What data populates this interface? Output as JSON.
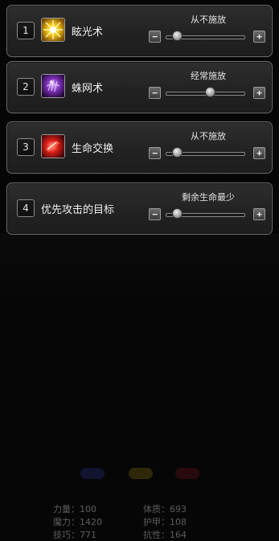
{
  "rules": [
    {
      "index": "1",
      "name": "眩光术",
      "icon": "glare-spell-icon",
      "mode": "从不施放",
      "level": 0.0
    },
    {
      "index": "2",
      "name": "蛛网术",
      "icon": "spider-web-spell-icon",
      "mode": "经常施放",
      "level": 0.5
    },
    {
      "index": "3",
      "name": "生命交换",
      "icon": "life-swap-spell-icon",
      "mode": "从不施放",
      "level": 0.0
    },
    {
      "index": "4",
      "name": "优先攻击的目标",
      "icon": "",
      "mode": "剩余生命最少",
      "level": 0.0
    }
  ],
  "buttons": {
    "minus": "−",
    "plus": "+"
  },
  "background_stats": {
    "left": [
      "力量：100",
      "魔力：1420",
      "技巧：771"
    ],
    "right": [
      "体质：693",
      "护甲：108",
      "抗性：164"
    ]
  },
  "colors": {
    "panel": "#262626",
    "border": "#6b6b6b",
    "text": "#e8e8e8"
  }
}
